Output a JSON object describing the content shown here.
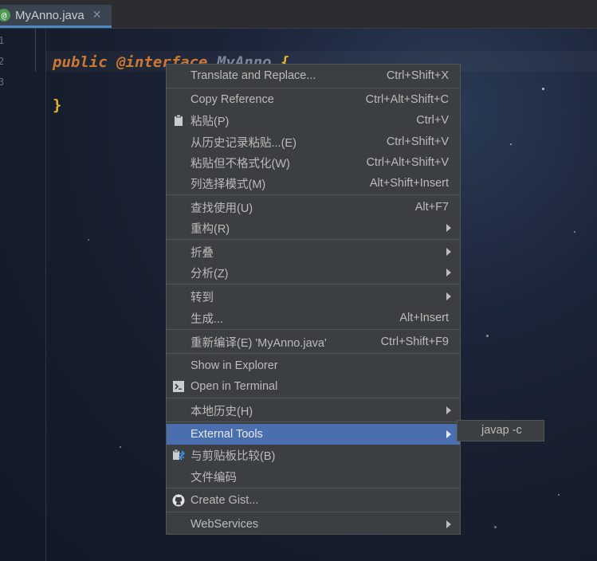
{
  "editor": {
    "tab": {
      "icon": "@",
      "title": "MyAnno.java",
      "close": "✕"
    },
    "line_numbers": [
      "1",
      "2",
      "3"
    ],
    "code": {
      "kw_public": "public",
      "kw_interface": "@interface",
      "class_name": "MyAnno",
      "open_brace": "{",
      "close_brace": "}"
    }
  },
  "context_menu": {
    "items": [
      {
        "label": "Translate and Replace...",
        "shortcut": "Ctrl+Shift+X"
      },
      {
        "label": "Copy Reference",
        "shortcut": "Ctrl+Alt+Shift+C"
      },
      {
        "label": "粘贴(P)",
        "shortcut": "Ctrl+V",
        "icon": "clipboard-icon"
      },
      {
        "label": "从历史记录粘贴...(E)",
        "shortcut": "Ctrl+Shift+V"
      },
      {
        "label": "粘贴但不格式化(W)",
        "shortcut": "Ctrl+Alt+Shift+V"
      },
      {
        "label": "列选择模式(M)",
        "shortcut": "Alt+Shift+Insert"
      },
      {
        "label": "查找使用(U)",
        "shortcut": "Alt+F7"
      },
      {
        "label": "重构(R)",
        "submenu": true
      },
      {
        "label": "折叠",
        "submenu": true
      },
      {
        "label": "分析(Z)",
        "submenu": true
      },
      {
        "label": "转到",
        "submenu": true
      },
      {
        "label": "生成...",
        "shortcut": "Alt+Insert"
      },
      {
        "label": "重新编译(E) 'MyAnno.java'",
        "shortcut": "Ctrl+Shift+F9"
      },
      {
        "label": "Show in Explorer"
      },
      {
        "label": "Open in Terminal",
        "icon": "terminal-icon"
      },
      {
        "label": "本地历史(H)",
        "submenu": true
      },
      {
        "label": "External Tools",
        "submenu": true,
        "selected": true
      },
      {
        "label": "与剪贴板比较(B)",
        "icon": "compare-icon"
      },
      {
        "label": "文件编码"
      },
      {
        "label": "Create Gist...",
        "icon": "github-icon"
      },
      {
        "label": "WebServices",
        "submenu": true
      }
    ],
    "submenu_items": [
      "javap -c"
    ]
  },
  "colors": {
    "menu_bg": "#3c3f41",
    "selection": "#4b6eaf",
    "keyword": "#cc7832"
  }
}
